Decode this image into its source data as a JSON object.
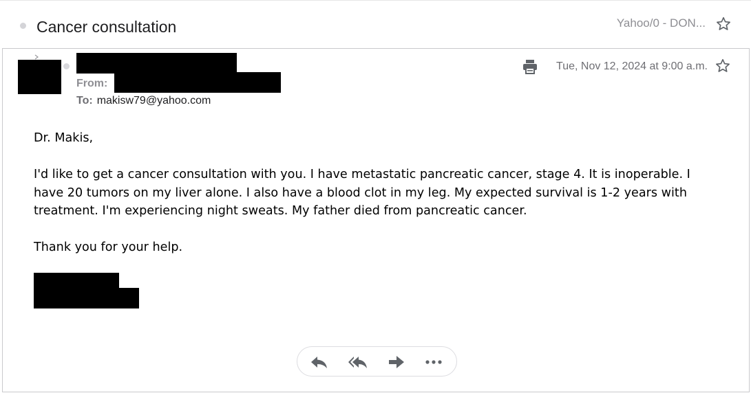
{
  "thread": {
    "subject": "Cancer consultation",
    "folder": "Yahoo/0 - DON..."
  },
  "message": {
    "from_label": "From:",
    "to_label": "To:",
    "to_address": "makisw79@yahoo.com",
    "date": "Tue, Nov 12, 2024 at 9:00 a.m.",
    "body": [
      "Dr. Makis,",
      "I'd like to get a cancer consultation with you. I have metastatic pancreatic cancer, stage 4.  It is inoperable. I have 20 tumors on my liver alone. I also have a blood clot in my leg. My expected survival  is 1-2 years with treatment. I'm experiencing night sweats. My father died from pancreatic cancer.",
      "Thank you for your help."
    ]
  },
  "icons": {
    "thread_star": "star-outline-icon",
    "message_star": "star-outline-icon",
    "print": "printer-icon",
    "reply": "reply-icon",
    "reply_all": "reply-all-icon",
    "forward": "forward-icon",
    "more": "more-horizontal-icon"
  },
  "colors": {
    "icon": "#5f6368",
    "muted_text": "#8e8e93",
    "redaction": "#000000"
  }
}
